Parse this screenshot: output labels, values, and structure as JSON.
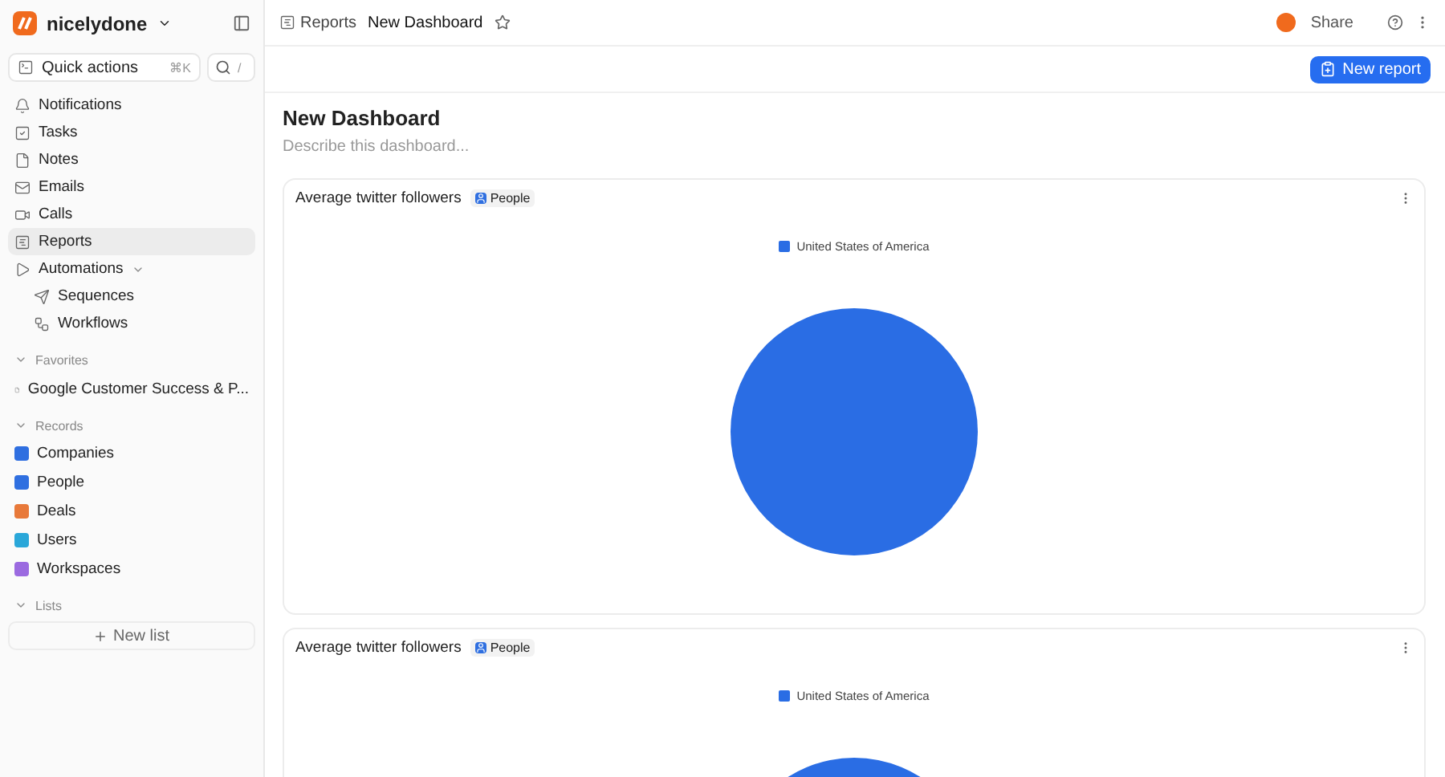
{
  "workspace": {
    "name": "nicelydone"
  },
  "quick_actions": {
    "label": "Quick actions",
    "shortcut": "⌘K",
    "search_shortcut": "/"
  },
  "nav": [
    {
      "label": "Notifications",
      "selected": false
    },
    {
      "label": "Tasks",
      "selected": false
    },
    {
      "label": "Notes",
      "selected": false
    },
    {
      "label": "Emails",
      "selected": false
    },
    {
      "label": "Calls",
      "selected": false
    },
    {
      "label": "Reports",
      "selected": true
    },
    {
      "label": "Automations",
      "selected": false,
      "expanded": true,
      "children": [
        {
          "label": "Sequences",
          "selected": false
        },
        {
          "label": "Workflows",
          "selected": false
        }
      ]
    }
  ],
  "favorites": {
    "title": "Favorites",
    "expanded": true,
    "items": [
      {
        "label": "Google Customer Success & P...",
        "selected": false
      }
    ]
  },
  "records": {
    "title": "Records",
    "expanded": true,
    "items": [
      {
        "label": "Companies",
        "color": "#2f6fe0"
      },
      {
        "label": "People",
        "color": "#2f6fe0"
      },
      {
        "label": "Deals",
        "color": "#e8793a"
      },
      {
        "label": "Users",
        "color": "#2aa7d9"
      },
      {
        "label": "Workspaces",
        "color": "#9b6ae0"
      }
    ]
  },
  "lists": {
    "title": "Lists",
    "expanded": true,
    "new_label": "New list"
  },
  "breadcrumb": [
    {
      "label": "Reports"
    },
    {
      "label": "New Dashboard"
    }
  ],
  "topbar": {
    "share": "Share",
    "starred": false
  },
  "new_report": "New report",
  "dashboard": {
    "title": "New Dashboard",
    "placeholder": "Describe this dashboard..."
  },
  "cards": [
    {
      "title": "Average twitter followers",
      "tag": "People",
      "legend": [
        {
          "label": "United States of America",
          "color": "#2a6de4"
        }
      ]
    },
    {
      "title": "Average twitter followers",
      "tag": "People",
      "legend": [
        {
          "label": "United States of America",
          "color": "#2a6de4"
        }
      ]
    }
  ]
}
